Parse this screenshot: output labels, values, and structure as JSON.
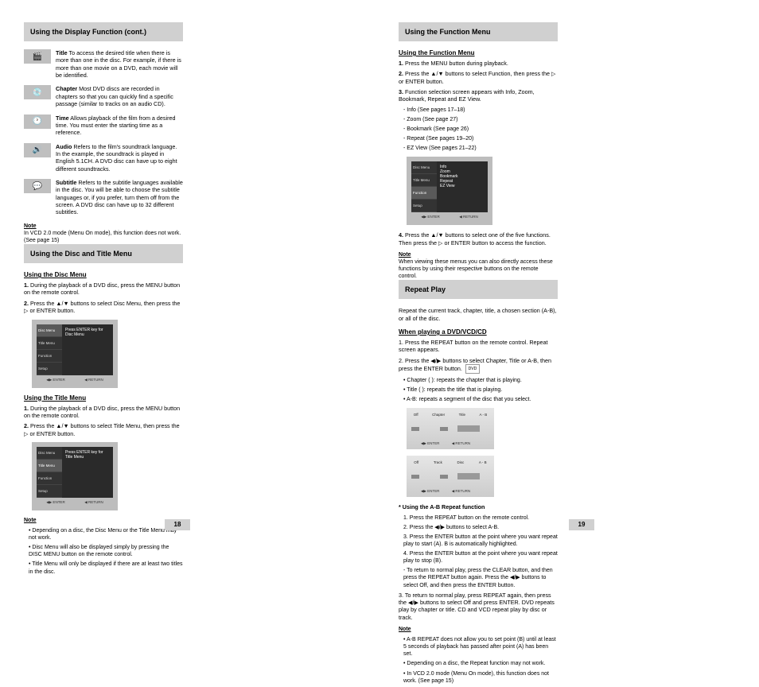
{
  "pageLeft": "18",
  "pageRight": "19",
  "left": {
    "colA": {
      "continued": "Using the Display Function (cont.)",
      "icons": [
        {
          "name": "title-icon",
          "label": "Title",
          "desc": "To access the desired title when there is more than one in the disc. For example, if there is more than one movie on a DVD, each movie will be identified."
        },
        {
          "name": "chapter-icon",
          "label": "Chapter",
          "desc": "Most DVD discs are recorded in chapters so that you can quickly find a specific passage (similar to tracks on an audio CD)."
        },
        {
          "name": "time-icon",
          "label": "Time",
          "desc": "Allows playback of the film from a desired time. You must enter the starting time as a reference."
        },
        {
          "name": "audio-icon",
          "label": "Audio",
          "desc": "Refers to the film's soundtrack language. In the example, the soundtrack is played in English 5.1CH. A DVD disc can have up to eight different soundtracks."
        },
        {
          "name": "subtitle-icon",
          "label": "Subtitle",
          "desc": "Refers to the subtitle languages available in the disc. You will be able to choose the subtitle languages or, if you prefer, turn them off from the screen. A DVD disc can have up to 32 different subtitles."
        }
      ],
      "noteHead": "Note",
      "noteBody": "In VCD 2.0 mode (Menu On mode), this function does not work. (See page 15)"
    },
    "colB": {
      "header": "Using the Disc and Title Menu",
      "discMenu": {
        "title": "Using the Disc Menu",
        "steps": [
          "During the playback of a DVD disc, press the MENU button on the remote control.",
          "Press the ▲/▼ buttons to select Disc Menu, then press the ▷ or ENTER button."
        ],
        "osd": {
          "side": [
            "Disc Menu",
            "Title Menu",
            "Function",
            "Setup"
          ],
          "main": "Press ENTER key for Disc Menu",
          "foot": [
            "◀▶ ENTER",
            "◀ RETURN"
          ]
        }
      },
      "titleMenu": {
        "title": "Using the Title Menu",
        "steps": [
          "During the playback of a DVD disc, press the MENU button on the remote control.",
          "Press the ▲/▼ buttons to select Title Menu, then press the ▷ or ENTER button."
        ],
        "osd": {
          "side": [
            "Disc Menu",
            "Title Menu",
            "Function",
            "Setup"
          ],
          "main": "Press ENTER key for Title Menu",
          "foot": [
            "◀▶ ENTER",
            "◀ RETURN"
          ]
        }
      },
      "noteHead": "Note",
      "notes": [
        "Depending on a disc, the Disc Menu or the Title Menu may not work.",
        "Disc Menu will also be displayed simply by pressing the DISC MENU button on the remote control.",
        "Title Menu will only be displayed if there are at least two titles in the disc."
      ]
    }
  },
  "right": {
    "colA": {
      "header": "Using the Function Menu",
      "subtitle": "Using the Function Menu",
      "steps1": [
        "Press the MENU button during playback.",
        "Press the ▲/▼ buttons to select Function, then press the ▷ or ENTER button.",
        "Function selection screen appears with Info, Zoom, Bookmark, Repeat and EZ View."
      ],
      "funcList": [
        "- Info (See pages 17–18)",
        "- Zoom (See page 27)",
        "- Bookmark (See page 26)",
        "- Repeat (See pages 19–20)",
        "- EZ View (See pages 21–22)"
      ],
      "osd": {
        "side": [
          "Disc Menu",
          "Title Menu",
          "Function",
          "Setup"
        ],
        "main": [
          "Info",
          "Zoom",
          "Bookmark",
          "Repeat",
          "EZ View"
        ],
        "foot": [
          "◀▶ ENTER",
          "◀ RETURN"
        ]
      },
      "steps2": [
        "Press the ▲/▼ buttons to select one of the five functions. Then press the ▷ or ENTER button to access the function.",
        "When viewing these menus you can also directly access these functions by using their respective buttons on the remote control."
      ],
      "noteHead": "Note"
    },
    "colB": {
      "header": "Repeat Play",
      "intro": "Repeat the current track, chapter, title, a chosen section (A-B), or all of the disc.",
      "subtitle": "When playing a DVD/VCD/CD",
      "step1": "1. Press the REPEAT button on the remote control. Repeat screen appears.",
      "step2head": "2. Press the ◀/▶ buttons to select Chapter, Title or A-B, then press the ENTER button.",
      "modes": [
        "Chapter ( ): repeats the chapter that is playing.",
        "Title ( ): repeats the title that is playing.",
        "A-B: repeats a segment of the disc that you select."
      ],
      "badge": "DVD",
      "chartA": {
        "items": [
          "Off",
          "Chapter",
          "Title",
          "A - B"
        ],
        "sub": [
          "◀▶ ENTER",
          "◀ RETURN"
        ]
      },
      "chartB": {
        "items": [
          "Off",
          "Track",
          "Disc",
          "A - B"
        ],
        "sub": [
          "◀▶ ENTER",
          "◀ RETURN"
        ]
      },
      "abTitle": "Using the A-B Repeat function",
      "abSteps": [
        "Press the REPEAT button on the remote control.",
        "Press the ◀/▶ buttons to select A-B.",
        "Press the ENTER button at the point where you want repeat play to start (A). B is automatically highlighted.",
        "Press the ENTER button at the point where you want repeat play to stop (B).",
        "To return to normal play, press the CLEAR button, and then press the REPEAT button again. Press the ◀/▶ buttons to select Off, and then press the ENTER button."
      ],
      "noteHead": "Note",
      "notes": [
        "A-B REPEAT does not allow you to set point (B) until at least 5 seconds of playback has passed after point (A) has been set.",
        "Depending on a disc, the Repeat function may not work.",
        "In VCD 2.0 mode (Menu On mode), this function does not work. (See page 15)"
      ],
      "step3": "3. To return to normal play, press REPEAT again, then press the ◀/▶ buttons to select Off and press ENTER. DVD repeats play by chapter or title. CD and VCD repeat play by disc or track."
    }
  }
}
